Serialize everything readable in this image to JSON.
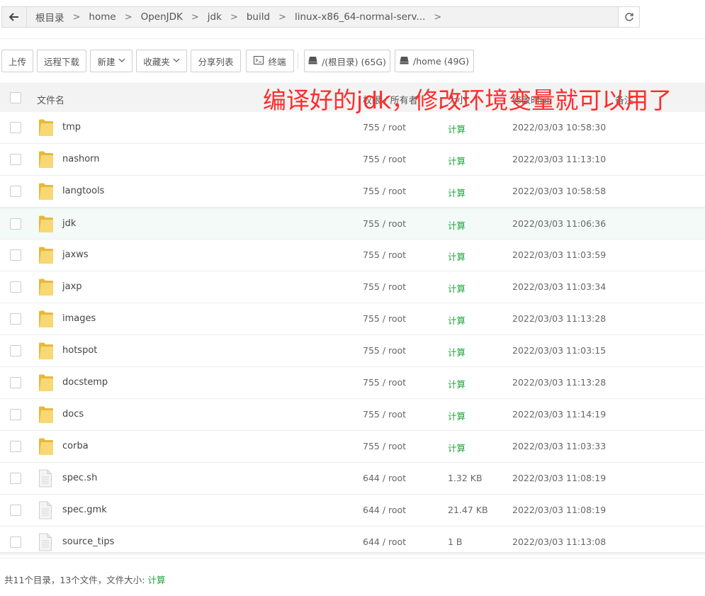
{
  "breadcrumb": [
    "根目录",
    "home",
    "OpenJDK",
    "jdk",
    "build",
    "linux-x86_64-normal-serv..."
  ],
  "toolbar": {
    "upload": "上传",
    "remote_download": "远程下载",
    "new": "新建",
    "favorites": "收藏夹",
    "share_list": "分享列表",
    "terminal": "终端",
    "disk_root": "/(根目录) (65G)",
    "disk_home": "/home (49G)"
  },
  "table": {
    "headers": {
      "name": "文件名",
      "perm": "权限 / 所有者",
      "size": "大小",
      "modified": "修改时间",
      "note": "备注"
    },
    "rows": [
      {
        "name": "tmp",
        "type": "folder",
        "perm": "755 / root",
        "size": "计算",
        "time": "2022/03/03 10:58:30"
      },
      {
        "name": "nashorn",
        "type": "folder",
        "perm": "755 / root",
        "size": "计算",
        "time": "2022/03/03 11:13:10"
      },
      {
        "name": "langtools",
        "type": "folder",
        "perm": "755 / root",
        "size": "计算",
        "time": "2022/03/03 10:58:58"
      },
      {
        "name": "jdk",
        "type": "folder",
        "perm": "755 / root",
        "size": "计算",
        "time": "2022/03/03 11:06:36"
      },
      {
        "name": "jaxws",
        "type": "folder",
        "perm": "755 / root",
        "size": "计算",
        "time": "2022/03/03 11:03:59"
      },
      {
        "name": "jaxp",
        "type": "folder",
        "perm": "755 / root",
        "size": "计算",
        "time": "2022/03/03 11:03:34"
      },
      {
        "name": "images",
        "type": "folder",
        "perm": "755 / root",
        "size": "计算",
        "time": "2022/03/03 11:13:28"
      },
      {
        "name": "hotspot",
        "type": "folder",
        "perm": "755 / root",
        "size": "计算",
        "time": "2022/03/03 11:03:15"
      },
      {
        "name": "docstemp",
        "type": "folder",
        "perm": "755 / root",
        "size": "计算",
        "time": "2022/03/03 11:13:28"
      },
      {
        "name": "docs",
        "type": "folder",
        "perm": "755 / root",
        "size": "计算",
        "time": "2022/03/03 11:14:19"
      },
      {
        "name": "corba",
        "type": "folder",
        "perm": "755 / root",
        "size": "计算",
        "time": "2022/03/03 11:03:33"
      },
      {
        "name": "spec.sh",
        "type": "file",
        "perm": "644 / root",
        "size": "1.32 KB",
        "time": "2022/03/03 11:08:19"
      },
      {
        "name": "spec.gmk",
        "type": "file",
        "perm": "644 / root",
        "size": "21.47 KB",
        "time": "2022/03/03 11:08:19"
      },
      {
        "name": "source_tips",
        "type": "file",
        "perm": "644 / root",
        "size": "1 B",
        "time": "2022/03/03 11:13:08"
      }
    ]
  },
  "annotation": "编译好的jdk，修改环境变量就可以用了",
  "footer": {
    "summary": "共11个目录，13个文件，文件大小:",
    "calc": "计算"
  },
  "colors": {
    "accent_green": "#20a53a",
    "annotation_red": "#ff2b2b",
    "highlight_row": "#f3faf7"
  }
}
